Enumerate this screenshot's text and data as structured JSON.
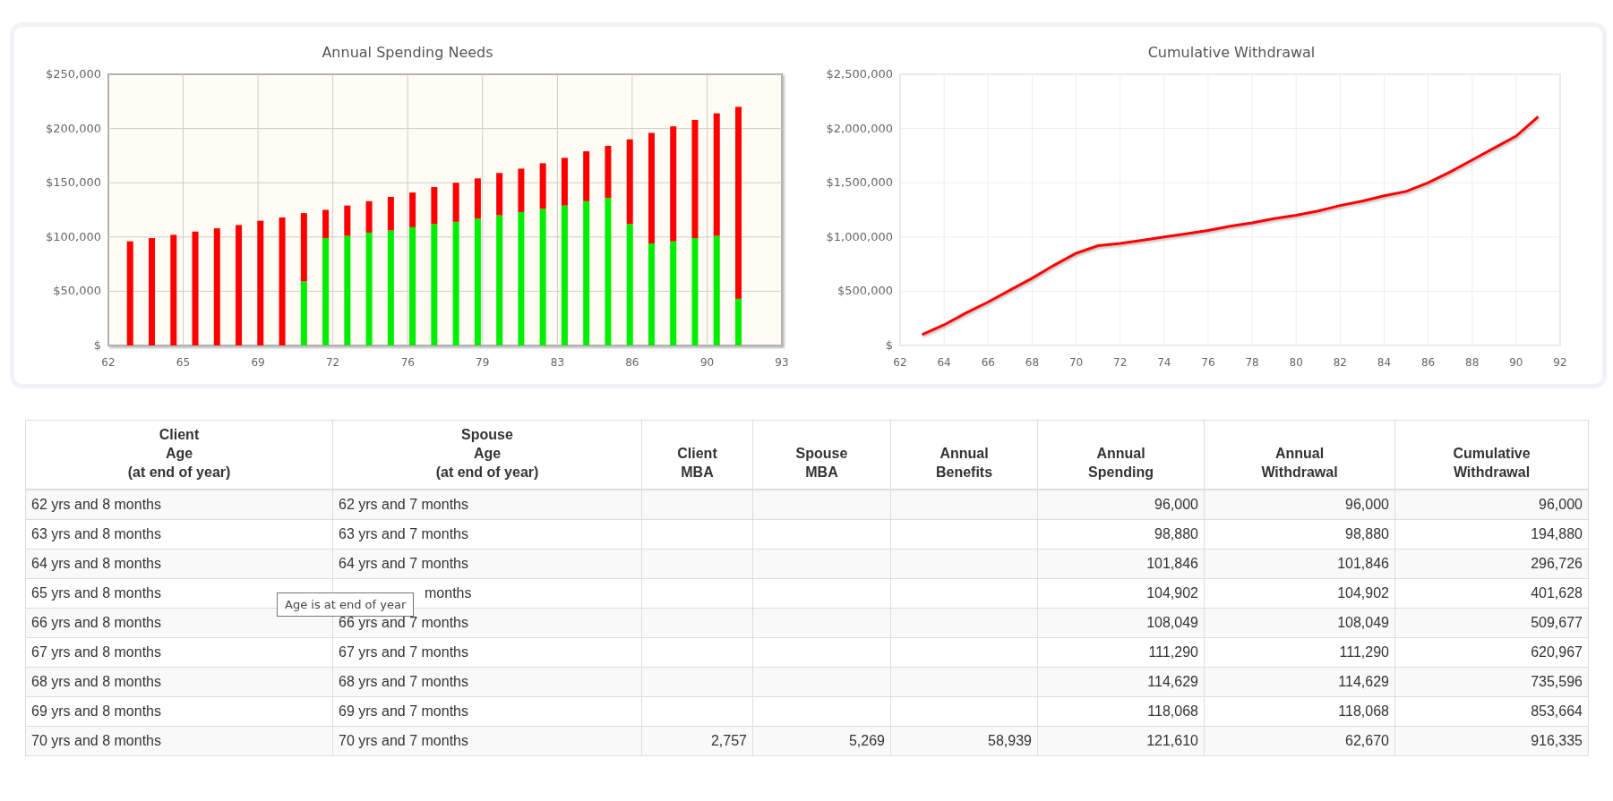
{
  "charts": [
    {
      "chart_data": {
        "type": "bar",
        "title": "Annual Spending Needs",
        "stacked": true,
        "grid": true,
        "x": [
          63,
          64,
          65,
          66,
          67,
          68,
          69,
          70,
          71,
          72,
          73,
          74,
          75,
          76,
          77,
          78,
          79,
          80,
          81,
          82,
          83,
          84,
          85,
          86,
          87,
          88,
          89,
          90,
          91
        ],
        "xlim": [
          62,
          93
        ],
        "ylim": [
          0,
          250000
        ],
        "xticks": [
          {
            "value": 62,
            "label": "62"
          },
          {
            "value": 65.44,
            "label": "65"
          },
          {
            "value": 68.89,
            "label": "69"
          },
          {
            "value": 72.33,
            "label": "72"
          },
          {
            "value": 75.78,
            "label": "76"
          },
          {
            "value": 79.22,
            "label": "79"
          },
          {
            "value": 82.67,
            "label": "83"
          },
          {
            "value": 86.11,
            "label": "86"
          },
          {
            "value": 89.56,
            "label": "90"
          },
          {
            "value": 93,
            "label": "93"
          }
        ],
        "yticks": [
          {
            "value": 0,
            "label": "$"
          },
          {
            "value": 50000,
            "label": "$50,000"
          },
          {
            "value": 100000,
            "label": "$100,000"
          },
          {
            "value": 150000,
            "label": "$150,000"
          },
          {
            "value": 200000,
            "label": "$200,000"
          },
          {
            "value": 250000,
            "label": "$250,000"
          }
        ],
        "series": [
          {
            "color": "#00ee00",
            "values": [
              0,
              0,
              0,
              0,
              0,
              0,
              0,
              0,
              59000,
              99000,
              101000,
              104000,
              106000,
              109000,
              112000,
              114000,
              117000,
              120000,
              123000,
              126000,
              129000,
              133000,
              136000,
              112000,
              94000,
              96000,
              99000,
              101000,
              43000
            ]
          },
          {
            "color": "#ff0000",
            "values": [
              96000,
              99000,
              102000,
              105000,
              108000,
              111000,
              115000,
              118000,
              63000,
              26000,
              28000,
              29000,
              31000,
              32000,
              34000,
              36000,
              37000,
              39000,
              40000,
              42000,
              44000,
              46000,
              48000,
              78000,
              102000,
              106000,
              109000,
              113000,
              177000
            ]
          }
        ]
      }
    },
    {
      "chart_data": {
        "type": "line",
        "title": "Cumulative Withdrawal",
        "grid": true,
        "x": [
          63,
          64,
          65,
          66,
          67,
          68,
          69,
          70,
          71,
          72,
          73,
          74,
          75,
          76,
          77,
          78,
          79,
          80,
          81,
          82,
          83,
          84,
          85,
          86,
          87,
          88,
          89,
          90,
          91
        ],
        "xlim": [
          62,
          92
        ],
        "ylim": [
          0,
          2500000
        ],
        "xticks": [
          62,
          64,
          66,
          68,
          70,
          72,
          74,
          76,
          78,
          80,
          82,
          84,
          86,
          88,
          90,
          92
        ],
        "yticks": [
          {
            "value": 0,
            "label": "$"
          },
          {
            "value": 500000,
            "label": "$500,000"
          },
          {
            "value": 1000000,
            "label": "$1,000,000"
          },
          {
            "value": 1500000,
            "label": "$1,500,000"
          },
          {
            "value": 2000000,
            "label": "$2,000,000"
          },
          {
            "value": 2500000,
            "label": "$2,500,000"
          }
        ],
        "series": [
          {
            "color": "#ff0000",
            "values": [
              100000,
              190000,
              300000,
              400000,
              510000,
              620000,
              740000,
              850000,
              920000,
              940000,
              970000,
              1000000,
              1030000,
              1060000,
              1100000,
              1130000,
              1170000,
              1200000,
              1240000,
              1290000,
              1330000,
              1380000,
              1420000,
              1500000,
              1600000,
              1710000,
              1820000,
              1930000,
              2110000
            ]
          }
        ]
      }
    }
  ],
  "table": {
    "columns": [
      "Client\nAge\n(at end of year)",
      "Spouse\nAge\n(at end of year)",
      "Client\nMBA",
      "Spouse\nMBA",
      "Annual\nBenefits",
      "Annual\nSpending",
      "Annual\nWithdrawal",
      "Cumulative\nWithdrawal"
    ],
    "rows": [
      [
        "62 yrs and 8 months",
        "62 yrs and 7 months",
        null,
        null,
        null,
        "96,000",
        "96,000",
        "96,000"
      ],
      [
        "63 yrs and 8 months",
        "63 yrs and 7 months",
        null,
        null,
        null,
        "98,880",
        "98,880",
        "194,880"
      ],
      [
        "64 yrs and 8 months",
        "64 yrs and 7 months",
        null,
        null,
        null,
        "101,846",
        "101,846",
        "296,726"
      ],
      [
        "65 yrs and 8 months",
        "months",
        null,
        null,
        null,
        "104,902",
        "104,902",
        "401,628"
      ],
      [
        "66 yrs and 8 months",
        "66 yrs and 7 months",
        null,
        null,
        null,
        "108,049",
        "108,049",
        "509,677"
      ],
      [
        "67 yrs and 8 months",
        "67 yrs and 7 months",
        null,
        null,
        null,
        "111,290",
        "111,290",
        "620,967"
      ],
      [
        "68 yrs and 8 months",
        "68 yrs and 7 months",
        null,
        null,
        null,
        "114,629",
        "114,629",
        "735,596"
      ],
      [
        "69 yrs and 8 months",
        "69 yrs and 7 months",
        null,
        null,
        null,
        "118,068",
        "118,068",
        "853,664"
      ],
      [
        "70 yrs and 8 months",
        "70 yrs and 7 months",
        "2,757",
        "5,269",
        "58,939",
        "121,610",
        "62,670",
        "916,335"
      ]
    ]
  },
  "tooltip": {
    "text": "Age is at end of year"
  }
}
